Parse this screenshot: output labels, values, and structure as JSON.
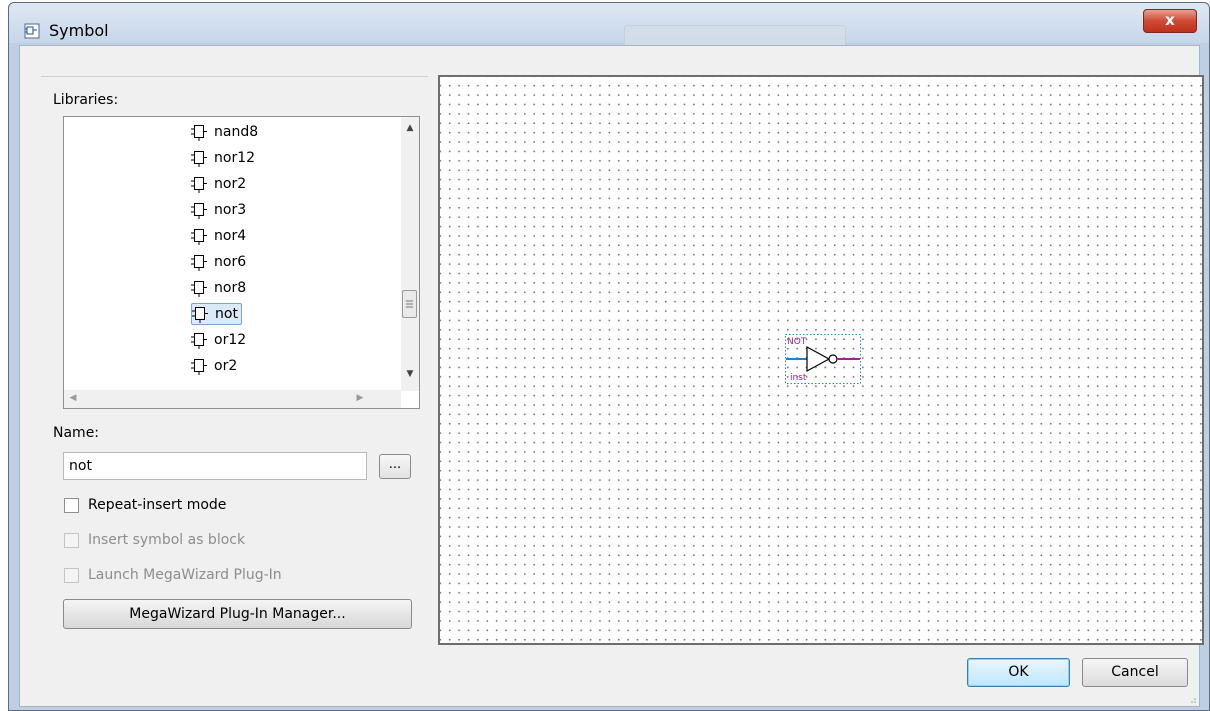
{
  "window": {
    "title": "Symbol",
    "close_glyph": "x",
    "title_icon": "symbol-window-icon"
  },
  "libraries": {
    "label": "Libraries:",
    "items": [
      {
        "label": "nand8",
        "icon": "gate-icon"
      },
      {
        "label": "nor12",
        "icon": "gate-icon"
      },
      {
        "label": "nor2",
        "icon": "gate-icon"
      },
      {
        "label": "nor3",
        "icon": "gate-icon"
      },
      {
        "label": "nor4",
        "icon": "gate-icon"
      },
      {
        "label": "nor6",
        "icon": "gate-icon"
      },
      {
        "label": "nor8",
        "icon": "gate-icon"
      },
      {
        "label": "not",
        "icon": "gate-icon",
        "selected": true
      },
      {
        "label": "or12",
        "icon": "gate-icon"
      },
      {
        "label": "or2",
        "icon": "gate-icon"
      }
    ]
  },
  "name": {
    "label": "Name:",
    "value": "not",
    "browse_label": "..."
  },
  "options": {
    "repeat_insert": {
      "label": "Repeat-insert mode",
      "checked": false,
      "enabled": true
    },
    "insert_as_block": {
      "label": "Insert symbol as block",
      "checked": false,
      "enabled": false
    },
    "launch_megawizard": {
      "label": "Launch MegaWizard Plug-In",
      "checked": false,
      "enabled": false
    }
  },
  "megawizard_button": "MegaWizard Plug-In Manager...",
  "preview": {
    "symbol_name": "NOT",
    "instance_name": "inst",
    "colors": {
      "symbol_text": "#a020a0",
      "input_wire": "#1f7fd0",
      "output_wire": "#a020a0",
      "bounding_box": "#2a8aa0"
    }
  },
  "buttons": {
    "ok": "OK",
    "cancel": "Cancel"
  }
}
